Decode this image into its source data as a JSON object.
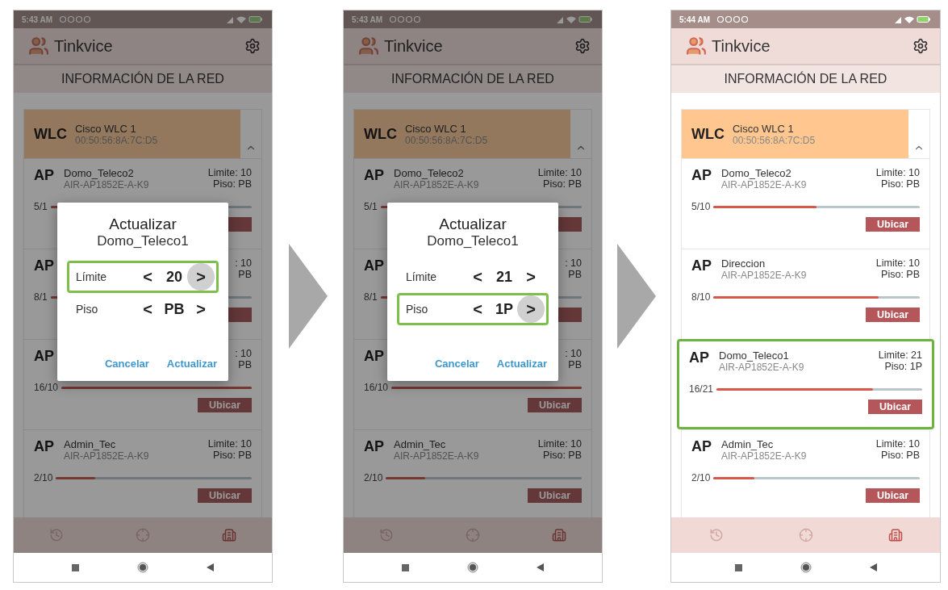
{
  "phones": [
    {
      "dimmed": true,
      "status_time": "5:43 AM",
      "app_title": "Tinkvice",
      "section_title": "INFORMACIÓN DE LA RED",
      "controller": {
        "label": "WLC",
        "name": "Cisco WLC 1",
        "mac": "00:50:56:8A:7C:D5",
        "expanded": true
      },
      "access_points": [
        {
          "label": "AP",
          "name": "Domo_Teleco2",
          "model": "AIR-AP1852E-A-K9",
          "limit": "Limite: 10",
          "floor": "Piso: PB",
          "counter": "5/1",
          "level": 0.5,
          "highlighted": false
        },
        {
          "label": "AP",
          "limit": ": 10",
          "floor": "PB",
          "counter": "8/1",
          "level": 0.8,
          "highlighted": false
        },
        {
          "label": "AP",
          "limit": ": 10",
          "floor": "PB",
          "counter": "16/10",
          "level": 1,
          "button": "Ubicar",
          "highlighted": false
        },
        {
          "label": "AP",
          "name": "Admin_Tec",
          "model": "AIR-AP1852E-A-K9",
          "limit": "Limite: 10",
          "floor": "Piso: PB",
          "counter": "2/10",
          "level": 0.2,
          "button": "Ubicar",
          "highlighted": false
        }
      ],
      "dialog": {
        "title": "Actualizar",
        "subtitle": "Domo_Teleco1",
        "rows": [
          {
            "label": "Límite",
            "prev": "<",
            "value": "20",
            "next": ">",
            "highlighted": true,
            "pressed": true
          },
          {
            "label": "Piso",
            "prev": "<",
            "value": "PB",
            "next": ">",
            "highlighted": false,
            "pressed": false
          }
        ],
        "buttons": [
          "Cancelar",
          "Actualizar"
        ]
      },
      "bottom_nav": [
        {
          "kind": "history",
          "selected": false
        },
        {
          "kind": "locate",
          "selected": false
        },
        {
          "kind": "building",
          "selected": true
        }
      ]
    },
    {
      "dimmed": true,
      "status_time": "5:43 AM",
      "app_title": "Tinkvice",
      "section_title": "INFORMACIÓN DE LA RED",
      "controller": {
        "label": "WLC",
        "name": "Cisco WLC 1",
        "mac": "00:50:56:8A:7C:D5",
        "expanded": true
      },
      "access_points": [
        {
          "label": "AP",
          "name": "Domo_Teleco2",
          "model": "AIR-AP1852E-A-K9",
          "limit": "Limite: 10",
          "floor": "Piso: PB",
          "counter": "5/1",
          "level": 0.5,
          "highlighted": false
        },
        {
          "label": "AP",
          "limit": ": 10",
          "floor": "PB",
          "counter": "8/1",
          "level": 0.8,
          "highlighted": false
        },
        {
          "label": "AP",
          "limit": ": 10",
          "floor": "PB",
          "counter": "16/10",
          "level": 1,
          "button": "Ubicar",
          "highlighted": false
        },
        {
          "label": "AP",
          "name": "Admin_Tec",
          "model": "AIR-AP1852E-A-K9",
          "limit": "Limite: 10",
          "floor": "Piso: PB",
          "counter": "2/10",
          "level": 0.2,
          "button": "Ubicar",
          "highlighted": false
        }
      ],
      "dialog": {
        "title": "Actualizar",
        "subtitle": "Domo_Teleco1",
        "rows": [
          {
            "label": "Límite",
            "prev": "<",
            "value": "21",
            "next": ">",
            "highlighted": false,
            "pressed": false
          },
          {
            "label": "Piso",
            "prev": "<",
            "value": "1P",
            "next": ">",
            "highlighted": true,
            "pressed": true
          }
        ],
        "buttons": [
          "Cancelar",
          "Actualizar"
        ]
      },
      "bottom_nav": [
        {
          "kind": "history",
          "selected": false
        },
        {
          "kind": "locate",
          "selected": false
        },
        {
          "kind": "building",
          "selected": true
        }
      ]
    },
    {
      "dimmed": false,
      "status_time": "5:44 AM",
      "app_title": "Tinkvice",
      "section_title": "INFORMACIÓN DE LA RED",
      "controller": {
        "label": "WLC",
        "name": "Cisco WLC 1",
        "mac": "00:50:56:8A:7C:D5",
        "expanded": true
      },
      "access_points": [
        {
          "label": "AP",
          "name": "Domo_Teleco2",
          "model": "AIR-AP1852E-A-K9",
          "limit": "Limite: 10",
          "floor": "Piso: PB",
          "counter": "5/10",
          "level": 0.5,
          "button": "Ubicar",
          "highlighted": false
        },
        {
          "label": "AP",
          "name": "Direccion",
          "model": "AIR-AP1852E-A-K9",
          "limit": "Limite: 10",
          "floor": "Piso: PB",
          "counter": "8/10",
          "level": 0.8,
          "button": "Ubicar",
          "highlighted": false
        },
        {
          "label": "AP",
          "name": "Domo_Teleco1",
          "model": "AIR-AP1852E-A-K9",
          "limit": "Limite: 21",
          "floor": "Piso: 1P",
          "counter": "16/21",
          "level": 0.76,
          "button": "Ubicar",
          "highlighted": true
        },
        {
          "label": "AP",
          "name": "Admin_Tec",
          "model": "AIR-AP1852E-A-K9",
          "limit": "Limite: 10",
          "floor": "Piso: PB",
          "counter": "2/10",
          "level": 0.2,
          "button": "Ubicar",
          "highlighted": false
        }
      ],
      "bottom_nav": [
        {
          "kind": "history",
          "selected": false
        },
        {
          "kind": "locate",
          "selected": false
        },
        {
          "kind": "building",
          "selected": true
        }
      ]
    }
  ]
}
